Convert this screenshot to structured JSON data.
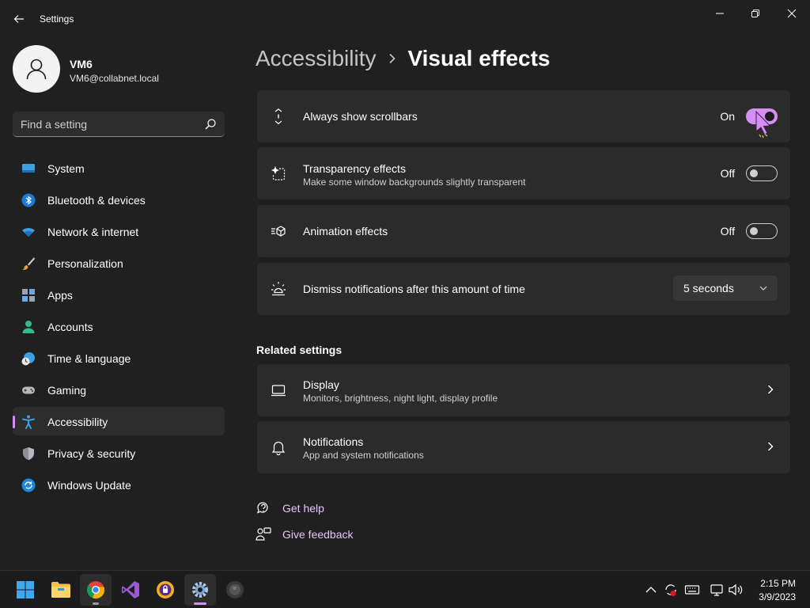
{
  "window": {
    "title": "Settings",
    "controls": [
      "minimize",
      "maximize",
      "close"
    ]
  },
  "profile": {
    "name": "VM6",
    "email": "VM6@collabnet.local"
  },
  "search": {
    "placeholder": "Find a setting",
    "value": ""
  },
  "sidebar": {
    "items": [
      {
        "label": "System",
        "icon": "system-icon",
        "selected": false
      },
      {
        "label": "Bluetooth & devices",
        "icon": "bluetooth-icon",
        "selected": false
      },
      {
        "label": "Network & internet",
        "icon": "wifi-icon",
        "selected": false
      },
      {
        "label": "Personalization",
        "icon": "brush-icon",
        "selected": false
      },
      {
        "label": "Apps",
        "icon": "apps-icon",
        "selected": false
      },
      {
        "label": "Accounts",
        "icon": "person-icon",
        "selected": false
      },
      {
        "label": "Time & language",
        "icon": "clock-globe-icon",
        "selected": false
      },
      {
        "label": "Gaming",
        "icon": "gamepad-icon",
        "selected": false
      },
      {
        "label": "Accessibility",
        "icon": "accessibility-icon",
        "selected": true
      },
      {
        "label": "Privacy & security",
        "icon": "shield-icon",
        "selected": false
      },
      {
        "label": "Windows Update",
        "icon": "update-icon",
        "selected": false
      }
    ]
  },
  "breadcrumb": {
    "parent": "Accessibility",
    "current": "Visual effects"
  },
  "settings": {
    "scrollbars": {
      "title": "Always show scrollbars",
      "state": "On",
      "on": true
    },
    "transparency": {
      "title": "Transparency effects",
      "description": "Make some window backgrounds slightly transparent",
      "state": "Off",
      "on": false
    },
    "animation": {
      "title": "Animation effects",
      "state": "Off",
      "on": false
    },
    "notifications_dismiss": {
      "title": "Dismiss notifications after this amount of time",
      "value": "5 seconds"
    }
  },
  "related": {
    "heading": "Related settings",
    "items": [
      {
        "title": "Display",
        "description": "Monitors, brightness, night light, display profile"
      },
      {
        "title": "Notifications",
        "description": "App and system notifications"
      }
    ]
  },
  "links": {
    "help": "Get help",
    "feedback": "Give feedback"
  },
  "taskbar": {
    "apps": [
      "start-icon",
      "file-explorer-icon",
      "chrome-icon",
      "visual-studio-icon",
      "vpn-icon",
      "settings-icon",
      "app-icon"
    ],
    "time": "2:15 PM",
    "date": "3/9/2023"
  },
  "colors": {
    "accent": "#d68ef5",
    "background": "#202020",
    "card": "#2b2b2b"
  }
}
